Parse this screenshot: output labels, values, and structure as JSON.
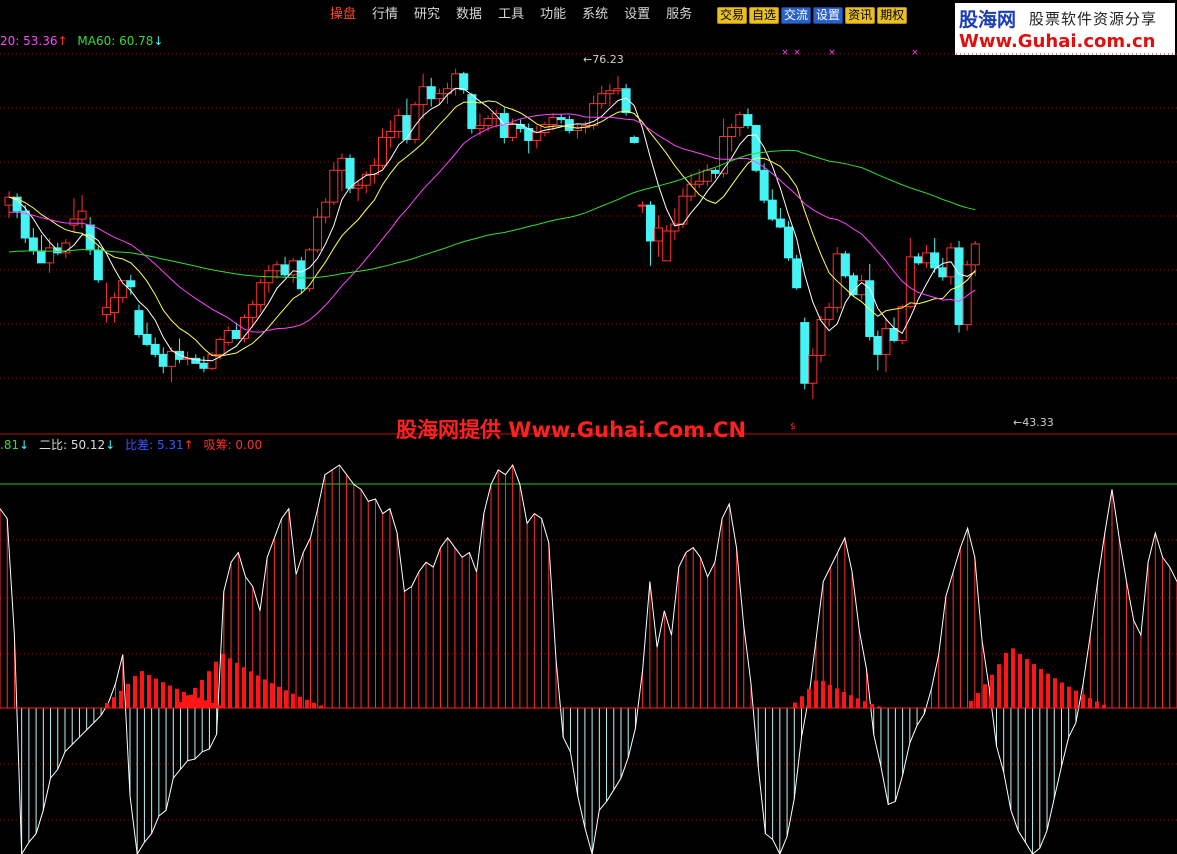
{
  "menu": {
    "items": [
      "操盘",
      "行情",
      "研究",
      "数据",
      "工具",
      "功能",
      "系统",
      "设置",
      "服务"
    ],
    "active_index": 0
  },
  "quick_buttons": [
    {
      "label": "交易",
      "color": "#e8c020"
    },
    {
      "label": "自选",
      "color": "#e8c020"
    },
    {
      "label": "交流",
      "color": "#2a62c8"
    },
    {
      "label": "设置",
      "color": "#2a62c8"
    },
    {
      "label": "资讯",
      "color": "#e8c020"
    },
    {
      "label": "期权",
      "color": "#e8c020"
    }
  ],
  "logo": {
    "name": "股海网",
    "tagline": "股票软件资源分享",
    "url": "Www.Guhai.com.cn"
  },
  "ma_legend": {
    "ma20": {
      "text": "20: 53.36",
      "arrow": "↑",
      "color": "#ff44ff"
    },
    "ma60": {
      "text": "MA60: 60.78",
      "arrow": "↓",
      "color": "#33dd33"
    }
  },
  "osc_legend": {
    "v1": {
      "text": ".81",
      "arrow": "↓",
      "color": "#33dd33"
    },
    "v2": {
      "text": "二比: 50.12",
      "arrow": "↓",
      "color": "#dddddd"
    },
    "v3": {
      "text": "比差: 5.31",
      "arrow": "↑",
      "color": "#3a56ff"
    },
    "v4": {
      "text": "吸筹: 0.00",
      "color": "#ff3030"
    }
  },
  "watermark": {
    "text": "股海网提供 Www.Guhai.Com.CN",
    "small": "$"
  },
  "colors": {
    "up": "#ff3030",
    "down": "#44f4f4",
    "ma5": "#ffffff",
    "ma10": "#ffff55",
    "ma20": "#ff44ff",
    "ma60": "#33dd33",
    "grid": "#8a1010",
    "divider": "#c01010",
    "osc_pos": "#ff3030",
    "osc_neg": "#bff3f3",
    "osc_line": "#ffffff",
    "absorb": "#ff1515"
  },
  "chart_data": [
    {
      "type": "candlestick",
      "title": "",
      "ylim": [
        40,
        80
      ],
      "annotations": {
        "high_label": "76.23",
        "low_label": "43.33"
      },
      "ohlc": [
        [
          62.8,
          64.2,
          61.5,
          63.6
        ],
        [
          63.6,
          64.0,
          61.5,
          62.2
        ],
        [
          62.2,
          62.8,
          59.0,
          59.5
        ],
        [
          59.5,
          60.5,
          57.8,
          58.2
        ],
        [
          58.2,
          59.8,
          57.2,
          57.0
        ],
        [
          57.0,
          59.5,
          56.0,
          58.5
        ],
        [
          58.5,
          59.0,
          57.8,
          58.0
        ],
        [
          58.0,
          59.4,
          57.5,
          59.0
        ],
        [
          60.8,
          63.5,
          60.0,
          61.4
        ],
        [
          61.4,
          63.8,
          60.5,
          62.2
        ],
        [
          60.8,
          61.6,
          57.8,
          58.3
        ],
        [
          58.3,
          58.8,
          55.0,
          55.3
        ],
        [
          51.8,
          55.0,
          51.0,
          52.5
        ],
        [
          52.0,
          54.0,
          51.0,
          53.5
        ],
        [
          53.5,
          55.0,
          53.0,
          55.2
        ],
        [
          55.2,
          55.8,
          53.8,
          54.6
        ],
        [
          52.2,
          52.8,
          49.5,
          49.8
        ],
        [
          49.8,
          51.0,
          48.6,
          48.8
        ],
        [
          48.8,
          49.5,
          47.5,
          47.8
        ],
        [
          47.8,
          48.5,
          45.9,
          46.6
        ],
        [
          46.6,
          48.5,
          45.0,
          48.1
        ],
        [
          48.1,
          49.4,
          46.9,
          47.3
        ],
        [
          47.3,
          48.1,
          46.7,
          47.4
        ],
        [
          47.4,
          47.8,
          46.9,
          46.9
        ],
        [
          46.9,
          47.6,
          46.0,
          46.4
        ],
        [
          46.4,
          48.0,
          46.2,
          47.8
        ],
        [
          47.8,
          49.5,
          47.3,
          49.3
        ],
        [
          49.0,
          50.6,
          48.7,
          50.2
        ],
        [
          50.2,
          51.0,
          49.3,
          49.4
        ],
        [
          49.4,
          51.8,
          49.0,
          51.5
        ],
        [
          51.5,
          53.2,
          50.5,
          52.8
        ],
        [
          52.8,
          55.4,
          52.0,
          55.0
        ],
        [
          55.0,
          56.8,
          54.0,
          56.2
        ],
        [
          56.2,
          57.2,
          55.4,
          56.8
        ],
        [
          56.8,
          57.6,
          55.5,
          55.8
        ],
        [
          55.8,
          57.5,
          55.0,
          57.2
        ],
        [
          57.2,
          57.6,
          53.9,
          54.4
        ],
        [
          54.4,
          58.5,
          54.1,
          58.3
        ],
        [
          58.3,
          62.5,
          58.0,
          61.6
        ],
        [
          61.6,
          63.5,
          61.0,
          63.1
        ],
        [
          63.1,
          67.1,
          62.8,
          66.3
        ],
        [
          66.3,
          68.0,
          64.2,
          67.5
        ],
        [
          67.5,
          67.9,
          64.0,
          64.5
        ],
        [
          64.5,
          65.2,
          63.2,
          64.8
        ],
        [
          64.8,
          66.2,
          64.0,
          65.9
        ],
        [
          65.9,
          67.5,
          65.0,
          66.8
        ],
        [
          66.8,
          70.5,
          66.5,
          69.6
        ],
        [
          69.6,
          71.3,
          68.6,
          70.2
        ],
        [
          70.2,
          72.5,
          69.5,
          71.8
        ],
        [
          71.8,
          73.5,
          69.0,
          69.4
        ],
        [
          69.4,
          73.2,
          69.0,
          72.9
        ],
        [
          72.9,
          76.0,
          71.5,
          74.7
        ],
        [
          74.7,
          75.6,
          72.7,
          73.5
        ],
        [
          73.5,
          74.5,
          72.9,
          74.0
        ],
        [
          74.0,
          75.1,
          73.0,
          74.5
        ],
        [
          74.5,
          76.5,
          73.8,
          76.0
        ],
        [
          76.0,
          76.2,
          74.0,
          74.4
        ],
        [
          73.9,
          74.1,
          70.0,
          70.5
        ],
        [
          70.5,
          72.0,
          69.8,
          70.8
        ],
        [
          70.8,
          71.8,
          70.2,
          71.5
        ],
        [
          71.5,
          72.4,
          70.6,
          72.0
        ],
        [
          72.0,
          72.6,
          69.0,
          69.6
        ],
        [
          69.6,
          71.5,
          69.2,
          70.9
        ],
        [
          70.9,
          71.4,
          70.1,
          70.5
        ],
        [
          70.5,
          71.0,
          68.0,
          69.3
        ],
        [
          69.3,
          70.8,
          68.5,
          70.1
        ],
        [
          70.1,
          71.2,
          69.7,
          70.9
        ],
        [
          70.9,
          72.0,
          70.3,
          71.6
        ],
        [
          71.6,
          72.0,
          71.0,
          71.4
        ],
        [
          71.4,
          71.8,
          70.0,
          70.3
        ],
        [
          70.3,
          71.0,
          69.5,
          70.6
        ],
        [
          70.6,
          71.2,
          70.0,
          70.8
        ],
        [
          70.8,
          73.8,
          70.4,
          73.0
        ],
        [
          73.0,
          74.8,
          72.5,
          74.0
        ],
        [
          74.0,
          75.0,
          72.8,
          74.3
        ],
        [
          74.3,
          75.8,
          73.9,
          74.5
        ],
        [
          74.5,
          75.0,
          71.8,
          72.1
        ],
        [
          69.6,
          69.8,
          69.0,
          69.1
        ],
        [
          62.8,
          63.2,
          62.0,
          62.8
        ],
        [
          62.8,
          63.2,
          56.7,
          59.2
        ],
        [
          59.2,
          61.8,
          57.6,
          60.5
        ],
        [
          57.2,
          60.8,
          57.2,
          60.2
        ],
        [
          60.2,
          62.5,
          59.3,
          60.9
        ],
        [
          60.9,
          64.5,
          60.5,
          63.7
        ],
        [
          63.7,
          66.0,
          63.2,
          64.9
        ],
        [
          64.9,
          66.4,
          64.5,
          65.2
        ],
        [
          65.2,
          66.9,
          64.7,
          66.3
        ],
        [
          66.3,
          66.5,
          65.5,
          66.0
        ],
        [
          66.0,
          71.5,
          65.6,
          69.7
        ],
        [
          69.7,
          71.0,
          68.2,
          70.6
        ],
        [
          70.6,
          72.2,
          69.7,
          71.9
        ],
        [
          71.9,
          72.5,
          70.5,
          70.8
        ],
        [
          70.8,
          70.9,
          66.1,
          66.3
        ],
        [
          66.3,
          67.0,
          63.0,
          63.3
        ],
        [
          63.3,
          64.4,
          61.2,
          61.4
        ],
        [
          61.4,
          62.5,
          60.5,
          60.6
        ],
        [
          60.6,
          61.2,
          57.2,
          57.5
        ],
        [
          57.4,
          57.8,
          54.3,
          54.5
        ],
        [
          51.0,
          51.5,
          44.3,
          44.9
        ],
        [
          44.9,
          48.4,
          43.3,
          47.7
        ],
        [
          47.7,
          51.7,
          47.0,
          51.3
        ],
        [
          51.3,
          53.0,
          50.6,
          52.5
        ],
        [
          52.5,
          58.6,
          52.0,
          57.9
        ],
        [
          57.9,
          58.2,
          55.5,
          55.7
        ],
        [
          55.7,
          56.0,
          53.6,
          53.8
        ],
        [
          53.8,
          55.8,
          53.3,
          55.2
        ],
        [
          55.2,
          56.9,
          49.2,
          49.6
        ],
        [
          49.6,
          50.2,
          46.2,
          47.8
        ],
        [
          47.8,
          51.5,
          46.0,
          50.4
        ],
        [
          50.4,
          51.5,
          49.0,
          49.2
        ],
        [
          49.2,
          52.8,
          48.8,
          52.6
        ],
        [
          52.6,
          59.5,
          52.4,
          57.6
        ],
        [
          57.6,
          58.0,
          56.8,
          57.0
        ],
        [
          57.0,
          58.8,
          56.5,
          58.0
        ],
        [
          58.0,
          59.5,
          56.0,
          56.5
        ],
        [
          56.5,
          57.5,
          55.2,
          55.6
        ],
        [
          55.6,
          59.0,
          54.8,
          58.5
        ],
        [
          58.5,
          59.2,
          50.0,
          50.8
        ],
        [
          50.8,
          57.2,
          50.2,
          56.8
        ],
        [
          56.8,
          59.2,
          55.7,
          58.9
        ]
      ]
    },
    {
      "type": "bar",
      "title": "",
      "ylim": [
        -100,
        100
      ],
      "series": [
        {
          "values": [
            82,
            78,
            30,
            -100,
            -92,
            -86,
            -70,
            -48,
            -42,
            -30,
            -25,
            -20,
            -15,
            -10,
            -5,
            2,
            10,
            22,
            -60,
            -100,
            -92,
            -86,
            -74,
            -70,
            -48,
            -42,
            -36,
            -35,
            -30,
            -28,
            -18,
            48,
            60,
            64,
            54,
            50,
            40,
            62,
            70,
            78,
            82,
            55,
            64,
            70,
            82,
            96,
            98,
            100,
            96,
            92,
            90,
            85,
            86,
            80,
            82,
            72,
            48,
            50,
            56,
            60,
            58,
            66,
            70,
            66,
            62,
            64,
            56,
            80,
            92,
            98,
            96,
            100,
            92,
            76,
            80,
            78,
            68,
            20,
            -20,
            -30,
            -60,
            -82,
            -100,
            -70,
            -64,
            -56,
            -48,
            -34,
            -14,
            16,
            52,
            25,
            40,
            30,
            58,
            64,
            66,
            62,
            54,
            60,
            78,
            84,
            66,
            34,
            10,
            -40,
            -86,
            -90,
            -100,
            -88,
            -62,
            -20,
            4,
            28,
            52,
            58,
            64,
            70,
            56,
            32,
            16,
            -18,
            -40,
            -66,
            -64,
            -46,
            -24,
            -12,
            -4,
            8,
            22,
            46,
            56,
            66,
            74,
            62,
            28,
            8,
            -26,
            -44,
            -70,
            -84,
            -92,
            -100,
            -96,
            -84,
            -62,
            -40,
            -20,
            -10,
            10,
            30,
            52,
            72,
            90,
            70,
            52,
            36,
            30,
            60,
            72,
            62,
            58,
            52
          ]
        },
        {
          "values": [
            0,
            0,
            0,
            0,
            0,
            0,
            0,
            0,
            0,
            0,
            0,
            0,
            0,
            0,
            0,
            0,
            0,
            0,
            0,
            0,
            0,
            0,
            0,
            0,
            0,
            0,
            0,
            0,
            0,
            0,
            0,
            0,
            0,
            0,
            0,
            0,
            0,
            0,
            0,
            0,
            0,
            0,
            0,
            0,
            0,
            0,
            0,
            0,
            0,
            0,
            0,
            0,
            0,
            0,
            0,
            0,
            0,
            0,
            0,
            0,
            0,
            0,
            0,
            0,
            0,
            0,
            0,
            0,
            0,
            0,
            0,
            0,
            0,
            0,
            0,
            0,
            0,
            0,
            0,
            0,
            0,
            0,
            0,
            0,
            0,
            0,
            0,
            0,
            0,
            0,
            0,
            0,
            0,
            0,
            0,
            0,
            0,
            0,
            0,
            0,
            0,
            0,
            0,
            0,
            0,
            0,
            0,
            0,
            0,
            0,
            0,
            0,
            0,
            0,
            0,
            0,
            0,
            0,
            0,
            0,
            0,
            0,
            0,
            0,
            0,
            0,
            0,
            0,
            0,
            0,
            0,
            0,
            0,
            0,
            0,
            0,
            0,
            0,
            0,
            0,
            0,
            0,
            0,
            0,
            0,
            0,
            0,
            0,
            0,
            0,
            0,
            0,
            0,
            0,
            0,
            0,
            0,
            0,
            0,
            0
          ]
        }
      ]
    }
  ]
}
